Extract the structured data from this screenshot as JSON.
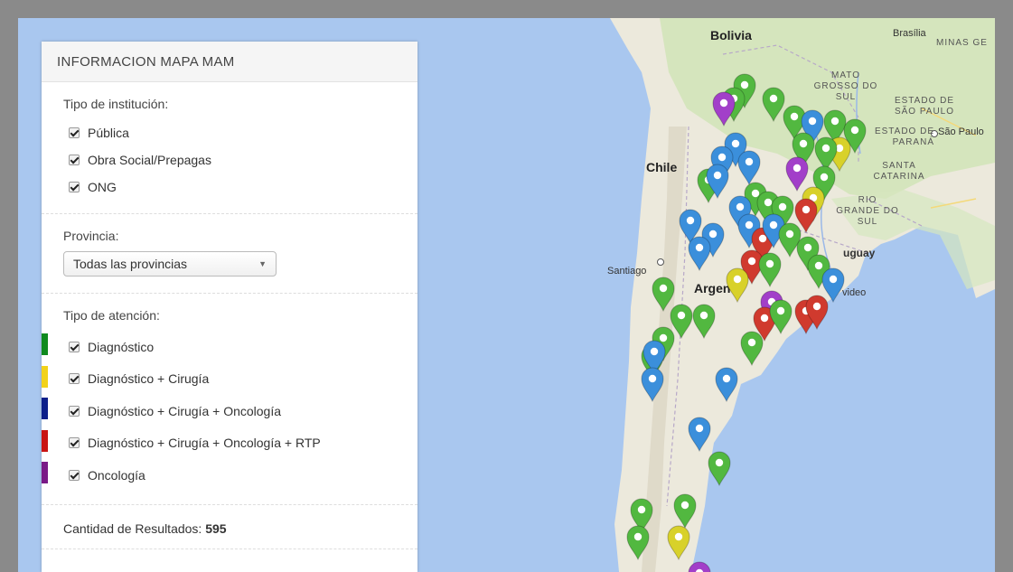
{
  "panel": {
    "title": "INFORMACION MAPA MAM",
    "institution": {
      "label": "Tipo de institución:",
      "options": [
        {
          "label": "Pública",
          "checked": true
        },
        {
          "label": "Obra Social/Prepagas",
          "checked": true
        },
        {
          "label": "ONG",
          "checked": true
        }
      ]
    },
    "province": {
      "label": "Provincia:",
      "selected": "Todas las provincias"
    },
    "attention": {
      "label": "Tipo de atención:",
      "options": [
        {
          "label": "Diagnóstico",
          "checked": true,
          "color": "#0f8a1e"
        },
        {
          "label": "Diagnóstico + Cirugía",
          "checked": true,
          "color": "#f2d21a"
        },
        {
          "label": "Diagnóstico + Cirugía + Oncología",
          "checked": true,
          "color": "#0c1f8a"
        },
        {
          "label": "Diagnóstico + Cirugía + Oncología + RTP",
          "checked": true,
          "color": "#c91414"
        },
        {
          "label": "Oncología",
          "checked": true,
          "color": "#7a1a86"
        }
      ]
    },
    "results": {
      "label": "Cantidad de Resultados:",
      "count": "595"
    }
  },
  "map": {
    "labels": {
      "bolivia": "Bolivia",
      "brasilia": "Brasília",
      "minas": "MINAS GE",
      "matogrosso": "MATO GROSSO DO SUL",
      "saopaulo_state": "ESTADO DE SÃO PAULO",
      "saopaulo": "São Paulo",
      "parana": "ESTADO DE PARANÁ",
      "santacatarina": "SANTA CATARINA",
      "riogrande": "RIO GRANDE DO SUL",
      "chile": "Chile",
      "santiago": "Santiago",
      "argentina": "Argen",
      "uruguay": "uguay",
      "montevideo": "video"
    },
    "pin_colors": {
      "green": "#52b840",
      "blue": "#3b8fdb",
      "yellow": "#d8d12a",
      "red": "#d03a2e",
      "purple": "#a23fc9"
    }
  }
}
